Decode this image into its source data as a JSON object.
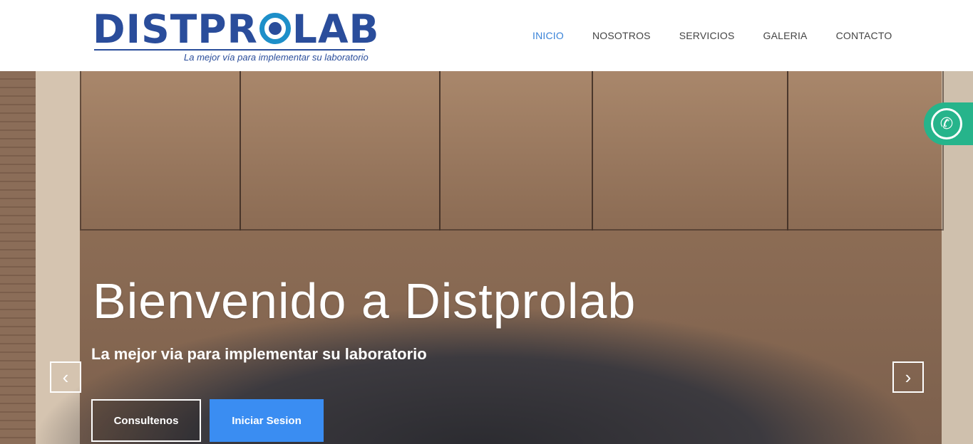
{
  "logo": {
    "prefix": "DISTPR",
    "o_letter": "",
    "suffix": "LAB",
    "tagline": "La mejor vía para implementar su laboratorio"
  },
  "nav": {
    "items": [
      {
        "label": "INICIO",
        "active": true
      },
      {
        "label": "NOSOTROS",
        "active": false
      },
      {
        "label": "SERVICIOS",
        "active": false
      },
      {
        "label": "GALERIA",
        "active": false
      },
      {
        "label": "CONTACTO",
        "active": false
      }
    ]
  },
  "hero": {
    "title": "Bienvenido a Distprolab",
    "subtitle": "La mejor via para implementar su laboratorio",
    "prev_icon": "chevron-left-icon",
    "next_icon": "chevron-right-icon",
    "buttons": {
      "consult": "Consultenos",
      "login": "Iniciar Sesion"
    }
  },
  "whatsapp": {
    "icon": "whatsapp-icon",
    "color": "#26b48b"
  },
  "colors": {
    "brand": "#2a4d9b",
    "accent": "#3a8df2",
    "nav_active": "#3a83d8"
  }
}
